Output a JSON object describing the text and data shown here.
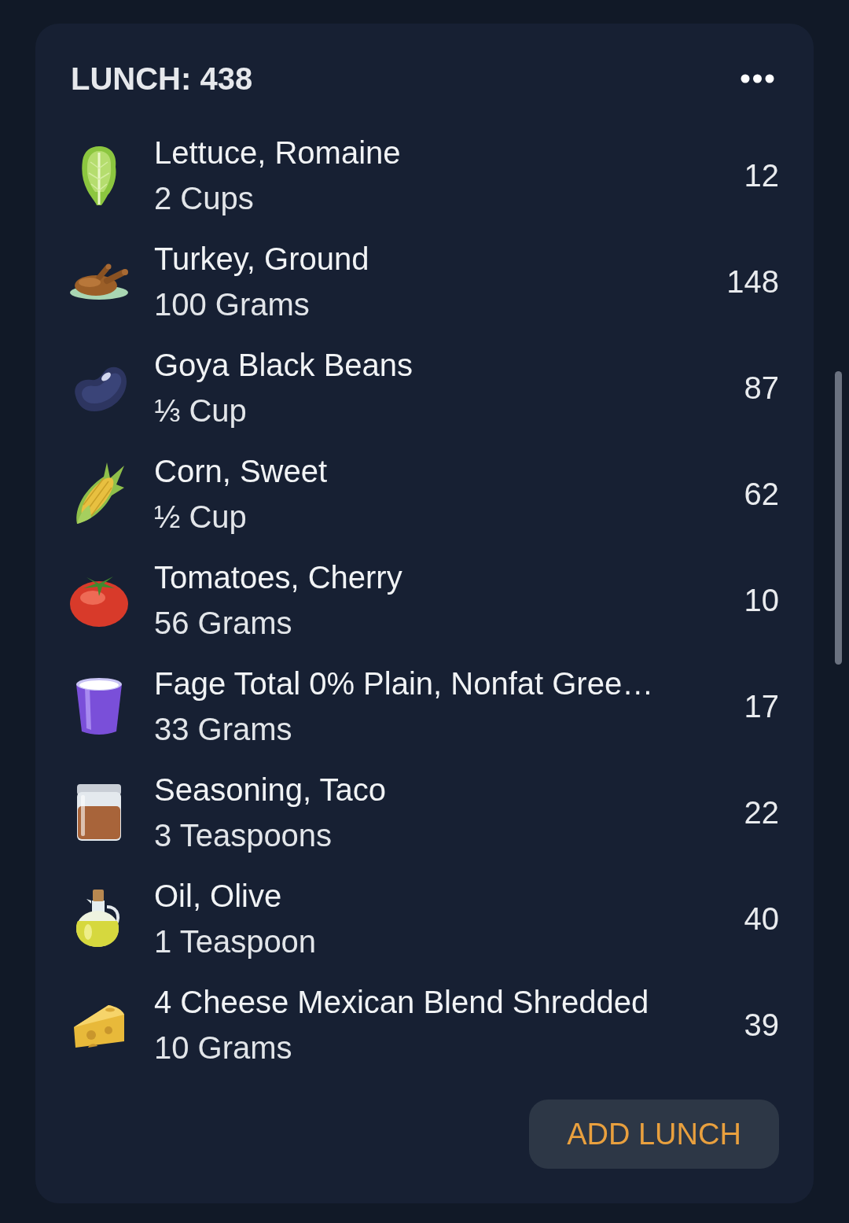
{
  "card": {
    "title": "LUNCH: 438",
    "items": [
      {
        "kind": "lettuce",
        "name": "Lettuce, Romaine",
        "serving": "2 Cups",
        "calories": "12"
      },
      {
        "kind": "poultry",
        "name": "Turkey, Ground",
        "serving": "100 Grams",
        "calories": "148"
      },
      {
        "kind": "bean",
        "name": "Goya Black Beans",
        "serving": "⅓ Cup",
        "calories": "87"
      },
      {
        "kind": "corn",
        "name": "Corn, Sweet",
        "serving": "½ Cup",
        "calories": "62"
      },
      {
        "kind": "tomato",
        "name": "Tomatoes, Cherry",
        "serving": "56 Grams",
        "calories": "10"
      },
      {
        "kind": "yogurt",
        "name": "Fage Total 0% Plain, Nonfat Gree…",
        "serving": "33 Grams",
        "calories": "17"
      },
      {
        "kind": "spice",
        "name": "Seasoning, Taco",
        "serving": "3 Teaspoons",
        "calories": "22"
      },
      {
        "kind": "oil",
        "name": "Oil, Olive",
        "serving": "1 Teaspoon",
        "calories": "40"
      },
      {
        "kind": "cheese",
        "name": "4 Cheese Mexican Blend Shredded",
        "serving": "10 Grams",
        "calories": "39"
      }
    ],
    "add_button": "ADD LUNCH"
  }
}
